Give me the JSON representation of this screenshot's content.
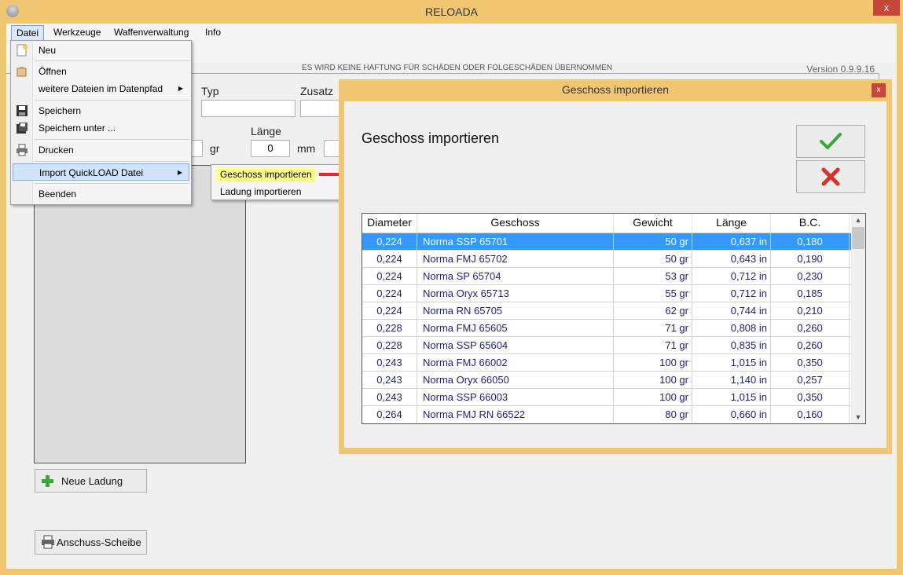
{
  "window": {
    "title": "RELOADA",
    "close_label": "x"
  },
  "menubar": {
    "items": [
      "Datei",
      "Werkzeuge",
      "Waffenverwaltung",
      "Info"
    ]
  },
  "banner": {
    "disclaimer": "ES WIRD KEINE HAFTUNG FÜR SCHÄDEN ODER FOLGESCHÄDEN ÜBERNOMMEN",
    "version": "Version 0.9.9.16"
  },
  "form": {
    "typ_label": "Typ",
    "zusatz_label": "Zusatz",
    "laenge_label": "Länge",
    "gr_unit": "gr",
    "laenge_value": "0",
    "mm_unit": "mm"
  },
  "buttons": {
    "neue_ladung": "Neue Ladung",
    "anschuss_scheibe": "Anschuss-Scheibe"
  },
  "datei_menu": {
    "items": [
      {
        "label": "Neu",
        "icon": "new-file-icon"
      },
      {
        "label": "Öffnen",
        "icon": "open-folder-icon"
      },
      {
        "label": "weitere Dateien im Datenpfad",
        "submenu": true
      },
      {
        "label": "Speichern",
        "icon": "save-icon"
      },
      {
        "label": "Speichern unter ...",
        "icon": "save-as-icon"
      },
      {
        "label": "Drucken",
        "icon": "printer-icon"
      },
      {
        "label": "Import QuickLOAD Datei",
        "submenu": true
      },
      {
        "label": "Beenden"
      }
    ]
  },
  "import_submenu": {
    "items": [
      "Geschoss importieren",
      "Ladung importieren"
    ]
  },
  "dialog": {
    "title": "Geschoss importieren",
    "heading": "Geschoss importieren",
    "close_label": "x",
    "ok_icon": "checkmark-icon",
    "cancel_icon": "red-x-icon",
    "columns": [
      "Diameter",
      "Geschoss",
      "Gewicht",
      "Länge",
      "B.C."
    ],
    "rows": [
      {
        "diameter": "0,224",
        "geschoss": "Norma SSP 65701",
        "gewicht": "50 gr",
        "laenge": "0,637 in",
        "bc": "0,180"
      },
      {
        "diameter": "0,224",
        "geschoss": "Norma FMJ 65702",
        "gewicht": "50 gr",
        "laenge": "0,643 in",
        "bc": "0,190"
      },
      {
        "diameter": "0,224",
        "geschoss": "Norma SP 65704",
        "gewicht": "53 gr",
        "laenge": "0,712 in",
        "bc": "0,230"
      },
      {
        "diameter": "0,224",
        "geschoss": "Norma Oryx 65713",
        "gewicht": "55 gr",
        "laenge": "0,712 in",
        "bc": "0,185"
      },
      {
        "diameter": "0,224",
        "geschoss": "Norma RN 65705",
        "gewicht": "62 gr",
        "laenge": "0,744 in",
        "bc": "0,210"
      },
      {
        "diameter": "0,228",
        "geschoss": "Norma FMJ 65605",
        "gewicht": "71 gr",
        "laenge": "0,808 in",
        "bc": "0,260"
      },
      {
        "diameter": "0,228",
        "geschoss": "Norma SSP 65604",
        "gewicht": "71 gr",
        "laenge": "0,835 in",
        "bc": "0,260"
      },
      {
        "diameter": "0,243",
        "geschoss": "Norma FMJ 66002",
        "gewicht": "100 gr",
        "laenge": "1,015 in",
        "bc": "0,350"
      },
      {
        "diameter": "0,243",
        "geschoss": "Norma Oryx 66050",
        "gewicht": "100 gr",
        "laenge": "1,140 in",
        "bc": "0,257"
      },
      {
        "diameter": "0,243",
        "geschoss": "Norma SSP 66003",
        "gewicht": "100 gr",
        "laenge": "1,015 in",
        "bc": "0,350"
      },
      {
        "diameter": "0,264",
        "geschoss": "Norma FMJ RN 66522",
        "gewicht": "80 gr",
        "laenge": "0,660 in",
        "bc": "0,160"
      }
    ],
    "selected_row": 0
  }
}
